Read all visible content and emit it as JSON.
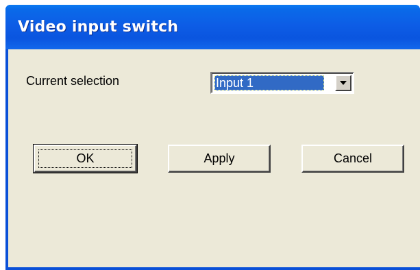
{
  "window": {
    "title": "Video input switch"
  },
  "form": {
    "label": "Current selection",
    "selection": {
      "value": "Input 1"
    }
  },
  "buttons": {
    "ok": "OK",
    "apply": "Apply",
    "cancel": "Cancel"
  },
  "icons": {
    "dropdown": "chevron-down-icon"
  },
  "colors": {
    "titlebar": "#0a5ae3",
    "dialog_background": "#ece9d8",
    "selection_highlight": "#316ac5"
  }
}
